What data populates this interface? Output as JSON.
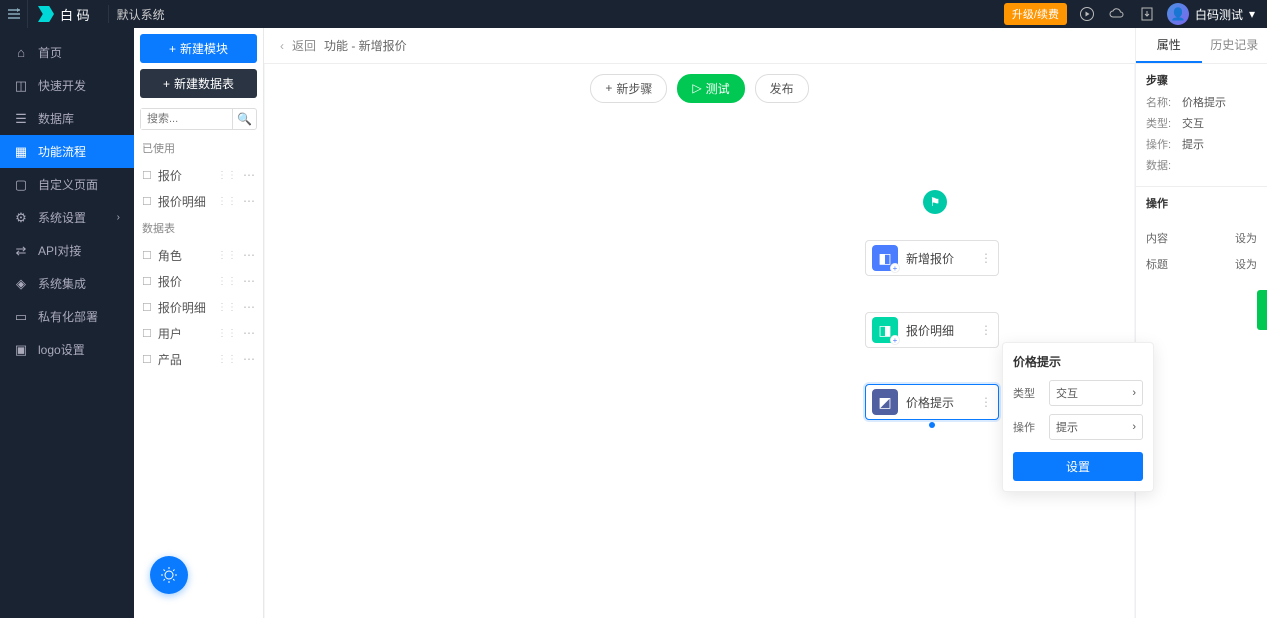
{
  "top": {
    "brand": "白 码",
    "system": "默认系统",
    "upgrade": "升级/续费",
    "user": "白码测试"
  },
  "nav": {
    "home": "首页",
    "quick": "快速开发",
    "db": "数据库",
    "flow": "功能流程",
    "page": "自定义页面",
    "sys": "系统设置",
    "api": "API对接",
    "integ": "系统集成",
    "deploy": "私有化部署",
    "logo": "logo设置"
  },
  "left": {
    "new_module": "新建模块",
    "new_table": "新建数据表",
    "search_ph": "搜索...",
    "used": "已使用",
    "tables": "数据表",
    "items_used": [
      "报价",
      "报价明细"
    ],
    "items_tables": [
      "角色",
      "报价",
      "报价明细",
      "用户",
      "产品"
    ]
  },
  "crumb": {
    "back": "返回",
    "title": "功能 - 新增报价"
  },
  "toolbar": {
    "newstep": "新步骤",
    "test": "测试",
    "publish": "发布"
  },
  "nodes": {
    "n1": "新增报价",
    "n2": "报价明细",
    "n3": "价格提示"
  },
  "popup": {
    "title": "价格提示",
    "type_lbl": "类型",
    "type_val": "交互",
    "op_lbl": "操作",
    "op_val": "提示",
    "setting": "设置"
  },
  "right": {
    "tab1": "属性",
    "tab2": "历史记录",
    "step": "步骤",
    "name_k": "名称:",
    "name_v": "价格提示",
    "type_k": "类型:",
    "type_v": "交互",
    "op_k": "操作:",
    "op_v": "提示",
    "data_k": "数据:",
    "data_v": "",
    "ops": "操作",
    "content": "内容",
    "setas": "设为",
    "title_k": "标题"
  }
}
